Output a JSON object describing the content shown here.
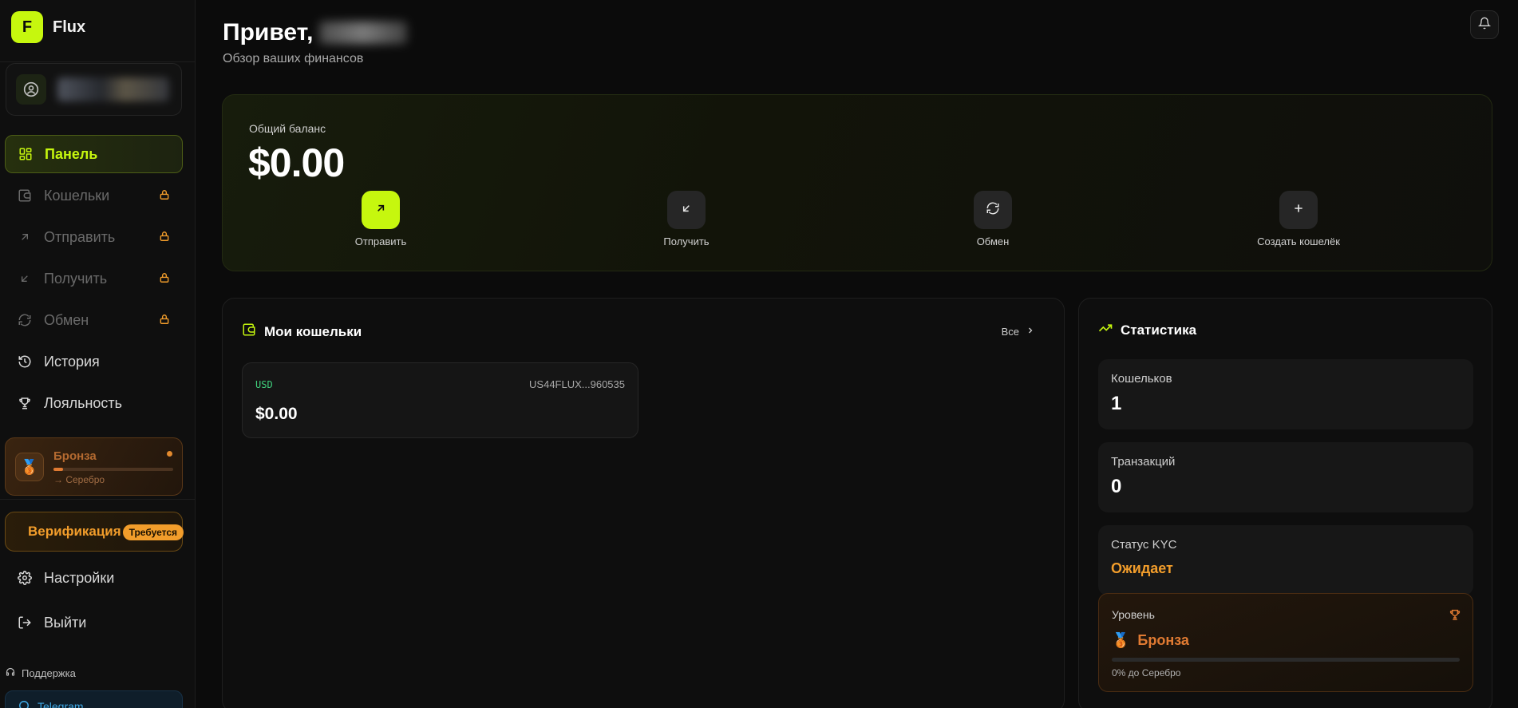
{
  "brand": {
    "logo_letter": "F",
    "name": "Flux"
  },
  "sidebar": {
    "items": [
      {
        "label": "Панель",
        "icon": "dashboard-icon",
        "active": true,
        "locked": false
      },
      {
        "label": "Кошельки",
        "icon": "wallet-icon",
        "active": false,
        "locked": true
      },
      {
        "label": "Отправить",
        "icon": "arrow-up-right-icon",
        "active": false,
        "locked": true
      },
      {
        "label": "Получить",
        "icon": "arrow-down-left-icon",
        "active": false,
        "locked": true
      },
      {
        "label": "Обмен",
        "icon": "exchange-icon",
        "active": false,
        "locked": true
      },
      {
        "label": "История",
        "icon": "history-icon",
        "active": false,
        "locked": false
      },
      {
        "label": "Лояльность",
        "icon": "trophy-icon",
        "active": false,
        "locked": false
      }
    ],
    "loyalty": {
      "title": "Бронза",
      "next": "→ Серебро",
      "progress": 0.08
    },
    "verification": {
      "label": "Верификация",
      "badge": "Требуется"
    },
    "bottom_items": [
      {
        "label": "Настройки",
        "icon": "gear-icon"
      },
      {
        "label": "Выйти",
        "icon": "logout-icon"
      }
    ],
    "support_label": "Поддержка",
    "telegram_label": "Telegram"
  },
  "header": {
    "greeting": "Привет,",
    "subtitle": "Обзор ваших финансов"
  },
  "balance": {
    "label": "Общий баланс",
    "value": "$0.00",
    "actions": [
      {
        "label": "Отправить",
        "icon": "arrow-up-right-icon"
      },
      {
        "label": "Получить",
        "icon": "arrow-down-left-icon"
      },
      {
        "label": "Обмен",
        "icon": "exchange-icon"
      },
      {
        "label": "Создать кошелёк",
        "icon": "plus-icon"
      }
    ]
  },
  "wallets": {
    "title": "Мои кошельки",
    "all_label": "Все",
    "items": [
      {
        "currency": "USD",
        "iban": "US44FLUX...960535",
        "amount": "$0.00"
      }
    ]
  },
  "stats": {
    "title": "Статистика",
    "wallets_label": "Кошельков",
    "wallets_value": "1",
    "tx_label": "Транзакций",
    "tx_value": "0",
    "kyc_label": "Статус KYC",
    "kyc_value": "Ожидает",
    "level_label": "Уровень",
    "level_name": "Бронза",
    "level_next": "0% до Серебро",
    "level_progress": 0
  },
  "colors": {
    "accent": "#c6f70e",
    "warning": "#f29d2b",
    "bronze": "#e07a32",
    "success": "#3fcf7c"
  }
}
